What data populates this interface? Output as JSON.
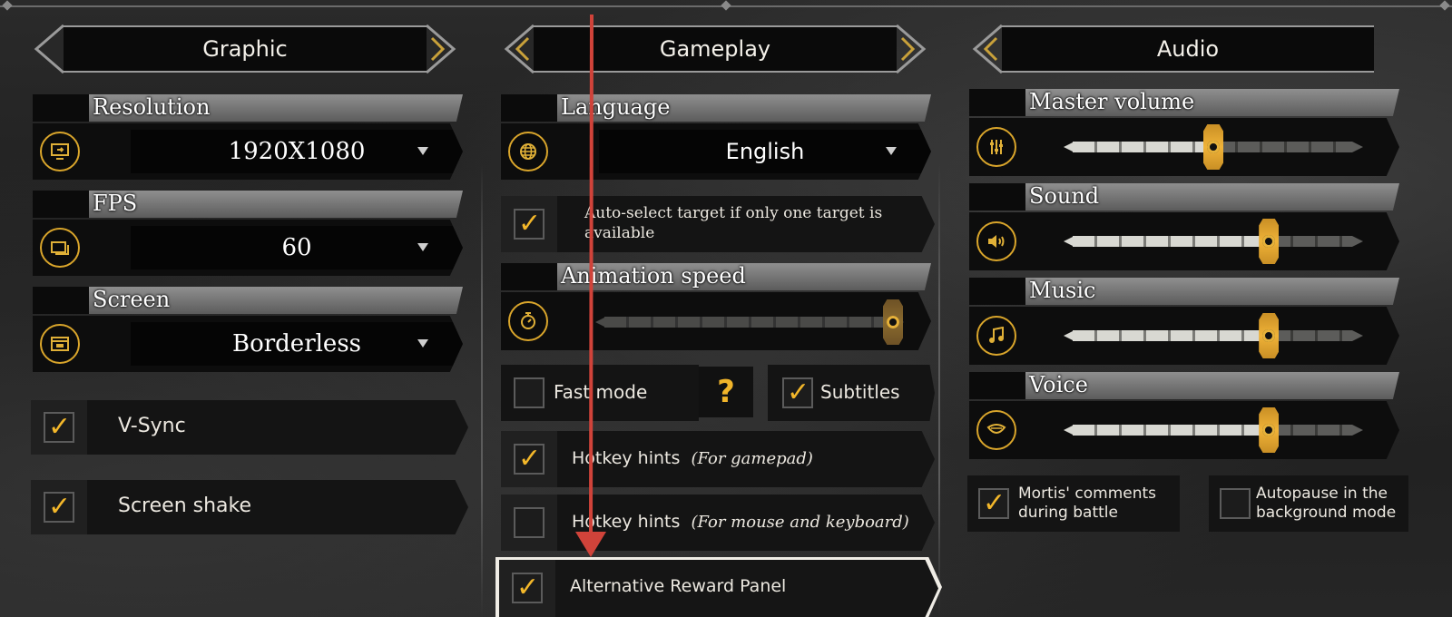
{
  "headers": {
    "graphic": "Graphic",
    "gameplay": "Gameplay",
    "audio": "Audio"
  },
  "graphic": {
    "resolution": {
      "title": "Resolution",
      "value": "1920X1080",
      "icon": "monitor-icon"
    },
    "fps": {
      "title": "FPS",
      "value": "60",
      "icon": "fps-icon"
    },
    "screen": {
      "title": "Screen",
      "value": "Borderless",
      "icon": "window-icon"
    },
    "vsync": {
      "label": "V-Sync",
      "checked": true
    },
    "shake": {
      "label": "Screen shake",
      "checked": true
    }
  },
  "gameplay": {
    "language": {
      "title": "Language",
      "value": "English",
      "icon": "globe-icon"
    },
    "autoselect": {
      "label": "Auto-select target if only one target is available",
      "checked": true
    },
    "animation": {
      "title": "Animation speed",
      "icon": "stopwatch-icon",
      "level": 1.0
    },
    "fastmode": {
      "label": "Fast mode",
      "checked": false
    },
    "help": "?",
    "subtitles": {
      "label": "Subtitles",
      "checked": true
    },
    "hotkey_gamepad": {
      "label": "Hotkey hints",
      "hint": "(For gamepad)",
      "checked": true
    },
    "hotkey_mouse": {
      "label": "Hotkey hints",
      "hint": "(For mouse and keyboard)",
      "checked": false
    },
    "alt_reward": {
      "label": "Alternative Reward Panel",
      "checked": true
    }
  },
  "audio": {
    "master": {
      "title": "Master volume",
      "icon": "mixer-icon",
      "level": 0.5
    },
    "sound": {
      "title": "Sound",
      "icon": "speaker-icon",
      "level": 0.7
    },
    "music": {
      "title": "Music",
      "icon": "music-note-icon",
      "level": 0.7
    },
    "voice": {
      "title": "Voice",
      "icon": "mouth-icon",
      "level": 0.7
    },
    "mortis": {
      "label": "Mortis' comments during battle",
      "checked": true
    },
    "autopause": {
      "label": "Autopause in the background mode",
      "checked": false
    }
  },
  "colors": {
    "accent": "#f3b72a",
    "arrow": "#d0433a"
  }
}
